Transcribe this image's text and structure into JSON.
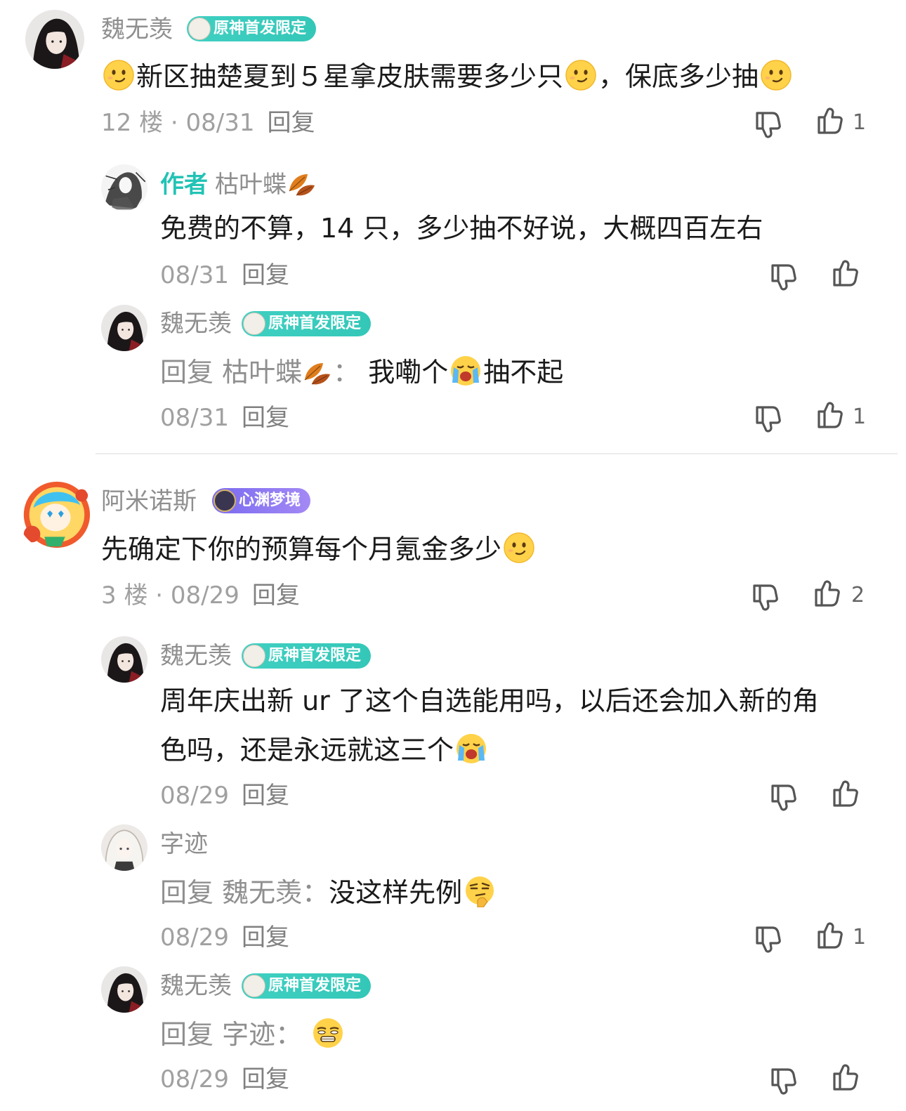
{
  "comments": [
    {
      "username": "魏无羡",
      "badge": "原神首发限定",
      "text_a": "新区抽楚夏到５星拿皮肤需要多少只",
      "text_b": "，保底多少抽",
      "floor": "12 楼",
      "sep": "·",
      "date": "08/31",
      "reply_label": "回复",
      "like_count": "1",
      "replies": [
        {
          "author_tag": "作者",
          "username": "枯叶蝶",
          "text": "免费的不算，14 只，多少抽不好说，大概四百左右",
          "date": "08/31",
          "reply_label": "回复",
          "like_count": ""
        },
        {
          "username": "魏无羡",
          "badge": "原神首发限定",
          "reply_prefix": "回复",
          "reply_to": "枯叶蝶",
          "colon": "：",
          "text_a": "我嘞个",
          "text_b": "抽不起",
          "date": "08/31",
          "reply_label": "回复",
          "like_count": "1"
        }
      ]
    },
    {
      "username": "阿米诺斯",
      "badge": "心渊梦境",
      "text": "先确定下你的预算每个月氪金多少",
      "floor": "3 楼",
      "sep": "·",
      "date": "08/29",
      "reply_label": "回复",
      "like_count": "2",
      "replies": [
        {
          "username": "魏无羡",
          "badge": "原神首发限定",
          "text_line1": "周年庆出新 ur 了这个自选能用吗，以后还会加入新的角",
          "text_line2": "色吗，还是永远就这三个",
          "date": "08/29",
          "reply_label": "回复",
          "like_count": ""
        },
        {
          "username": "字迹",
          "reply_prefix": "回复",
          "reply_to": "魏无羡",
          "colon": "：",
          "text": "没这样先例",
          "date": "08/29",
          "reply_label": "回复",
          "like_count": "1"
        },
        {
          "username": "魏无羡",
          "badge": "原神首发限定",
          "reply_prefix": "回复",
          "reply_to": "字迹",
          "colon": "：",
          "date": "08/29",
          "reply_label": "回复",
          "like_count": ""
        }
      ]
    }
  ],
  "icons": {
    "dislike": "thumbs-down-icon",
    "like": "thumbs-up-icon",
    "emoji_smirk": "smirk-emoji",
    "emoji_cry": "crying-emoji",
    "emoji_think": "thinking-emoji",
    "emoji_meh": "unamused-emoji",
    "leaf": "autumn-leaf-icon"
  },
  "colors": {
    "author_tag": "#22c3b5",
    "badge_teal": "#3fd0c2",
    "badge_purple": "#8b76f2",
    "meta_gray": "#a0a0a0"
  }
}
